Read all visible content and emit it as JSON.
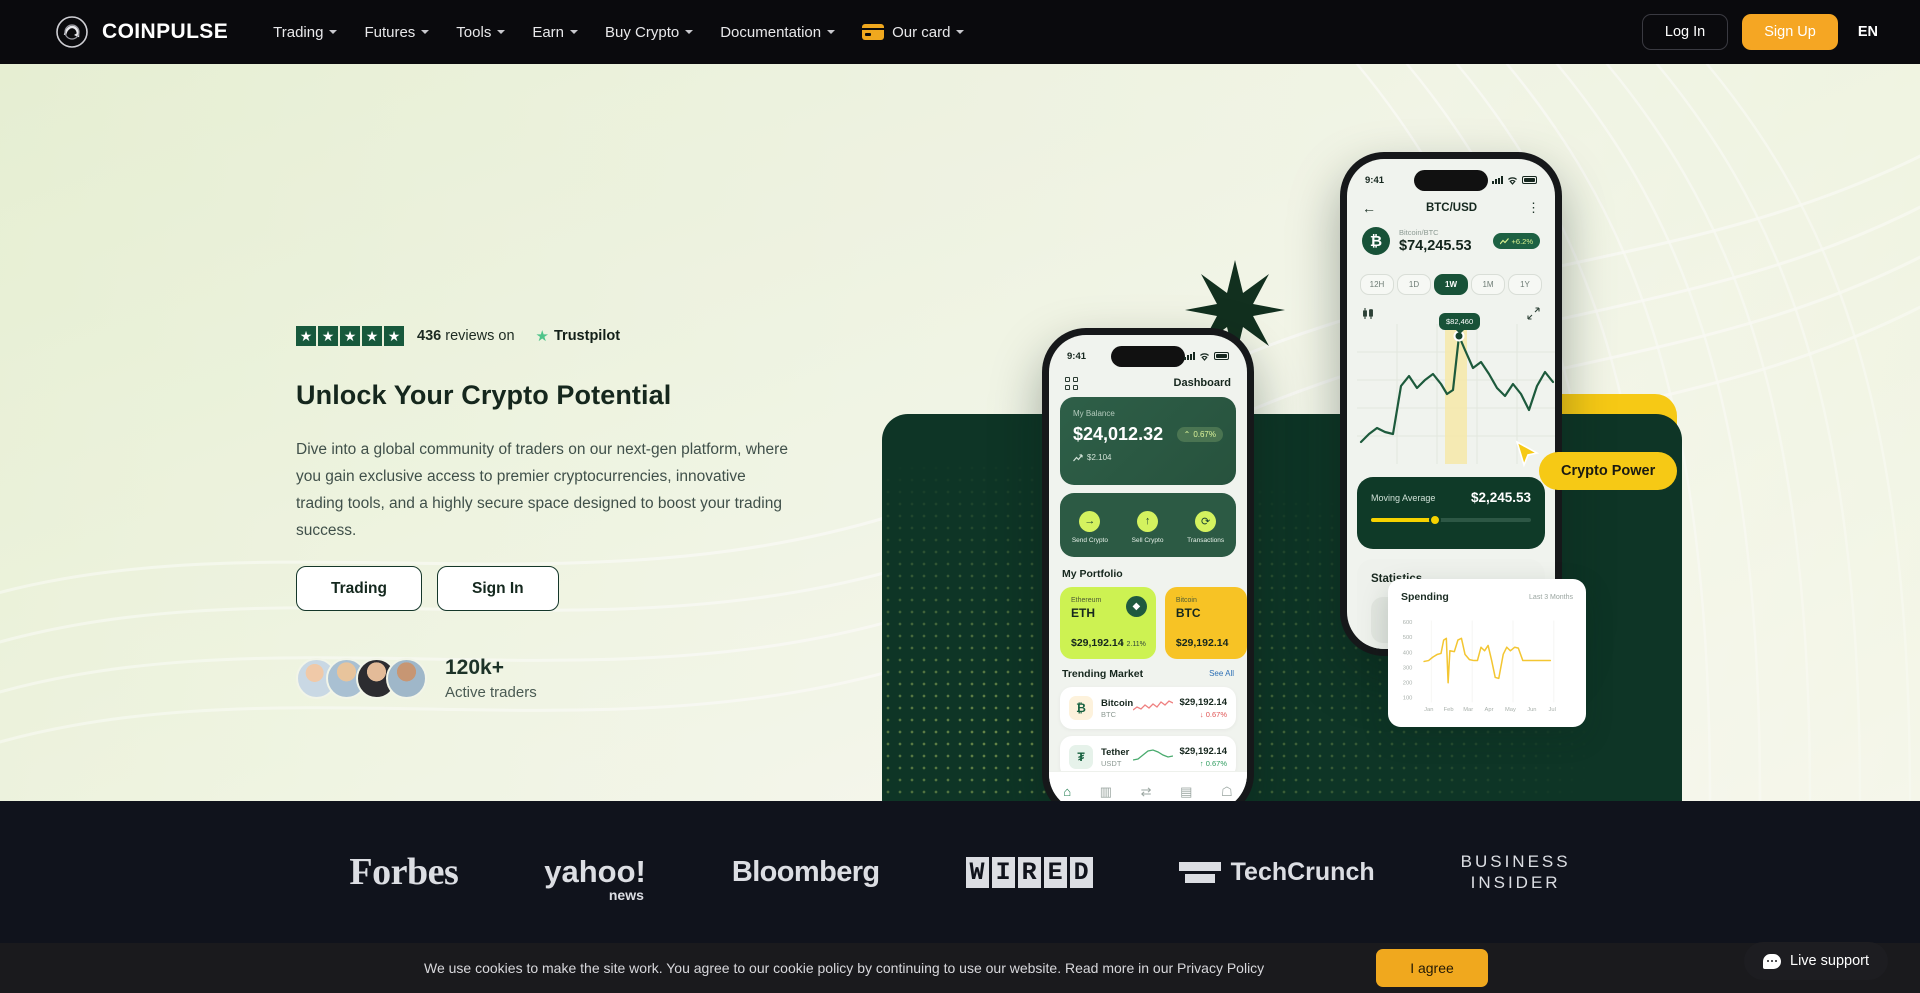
{
  "navbar": {
    "brand": "COINPULSE",
    "links": [
      {
        "label": "Trading",
        "caret": true
      },
      {
        "label": "Futures",
        "caret": true
      },
      {
        "label": "Tools",
        "caret": true
      },
      {
        "label": "Earn",
        "caret": true
      },
      {
        "label": "Buy Crypto",
        "caret": true
      },
      {
        "label": "Documentation",
        "caret": true
      },
      {
        "label": "Our card",
        "caret": true
      }
    ],
    "login": "Log In",
    "signup": "Sign Up",
    "lang": "EN"
  },
  "hero": {
    "trustpilot": {
      "stars": 5,
      "count": "436",
      "reviews_text": "reviews on",
      "brand": "Trustpilot"
    },
    "title": "Unlock Your Crypto Potential",
    "body": "Dive into a global community of traders on our next-gen platform, where you gain exclusive access to premier cryptocurrencies, innovative trading tools, and a highly secure space designed to boost your trading success.",
    "primary_btn": "Trading",
    "secondary_btn": "Sign In",
    "traders_count": "120k+",
    "traders_label": "Active traders",
    "badge": "Crypto Power"
  },
  "phone_front": {
    "time": "9:41",
    "title": "Dashboard",
    "balance_label": "My Balance",
    "balance_amount": "$24,012.32",
    "balance_change": "0.67%",
    "balance_sub": "$2.104",
    "actions": [
      {
        "label": "Send Crypto",
        "icon": "arrow-right-icon"
      },
      {
        "label": "Sell Crypto",
        "icon": "arrow-up-icon"
      },
      {
        "label": "Transactions",
        "icon": "refresh-icon"
      }
    ],
    "portfolio_title": "My Portfolio",
    "portfolio": [
      {
        "name": "Ethereum",
        "symbol": "ETH",
        "value": "$29,192.14",
        "change": "2.11%"
      },
      {
        "name": "Bitcoin",
        "symbol": "BTC",
        "value": "$29,192.14",
        "change": ""
      }
    ],
    "trending_title": "Trending Market",
    "see_all": "See All",
    "trending": [
      {
        "name": "Bitcoin",
        "symbol": "BTC",
        "price": "$29,192.14",
        "change": "0.67%",
        "dir": "down"
      },
      {
        "name": "Tether",
        "symbol": "USDT",
        "price": "$29,192.14",
        "change": "0.67%",
        "dir": "up"
      }
    ],
    "tabs": [
      "home-icon",
      "chart-icon",
      "swap-icon",
      "wallet-icon",
      "profile-icon"
    ]
  },
  "phone_back": {
    "time": "9:41",
    "title": "BTC/USD",
    "coin_label": "Bitcoin/BTC",
    "coin_price": "$74,245.53",
    "coin_change": "+6.2%",
    "ranges": [
      "12H",
      "1D",
      "1W",
      "1M",
      "1Y"
    ],
    "active_range": "1W",
    "tooltip": "$82,460",
    "ma_label": "Moving Average",
    "ma_value": "$2,245.53",
    "stats_title": "Statistics"
  },
  "spending_card": {
    "title": "Spending",
    "subtitle": "Last 3 Months"
  },
  "chart_data": {
    "type": "line",
    "title": "Spending",
    "subtitle": "Last 3 Months",
    "xlabel": "",
    "ylabel": "",
    "categories": [
      "Jan",
      "Feb",
      "Mar",
      "Apr",
      "May",
      "Jun",
      "Jul"
    ],
    "ylim": [
      100,
      600
    ],
    "yticks": [
      100,
      200,
      300,
      400,
      500,
      600
    ],
    "grid": true,
    "legend": "none",
    "color": "#f3c632",
    "series": [
      {
        "name": "Spending",
        "values": [
          350,
          360,
          380,
          395,
          400,
          470,
          490,
          210,
          420,
          415,
          470,
          490,
          400,
          365,
          360,
          362,
          430,
          415,
          440,
          360,
          245,
          240,
          400,
          430,
          415,
          430,
          425,
          360,
          358,
          358,
          358
        ]
      }
    ]
  },
  "btc_chart": {
    "type": "line",
    "title": "BTC/USD",
    "tooltip_value": "$82,460",
    "color": "#1d5a3c",
    "values": [
      18,
      22,
      30,
      28,
      26,
      62,
      70,
      58,
      62,
      70,
      60,
      52,
      58,
      56,
      60,
      56,
      90,
      96,
      74,
      80,
      72,
      56,
      50,
      58,
      52,
      40,
      48,
      66,
      70,
      60,
      55
    ]
  },
  "press": [
    {
      "name": "Forbes"
    },
    {
      "name": "yahoo!",
      "sub": "news"
    },
    {
      "name": "Bloomberg"
    },
    {
      "name": "WIRED",
      "letters": [
        "W",
        "I",
        "R",
        "E",
        "D"
      ]
    },
    {
      "name": "TechCrunch"
    },
    {
      "name": "BUSINESS INSIDER",
      "line1": "BUSINESS",
      "line2": "INSIDER"
    }
  ],
  "cookie": {
    "text": "We use cookies to make the site work. You agree to our cookie policy by continuing to use our website. Read more in our Privacy Policy",
    "button": "I agree"
  },
  "live_support": "Live support"
}
